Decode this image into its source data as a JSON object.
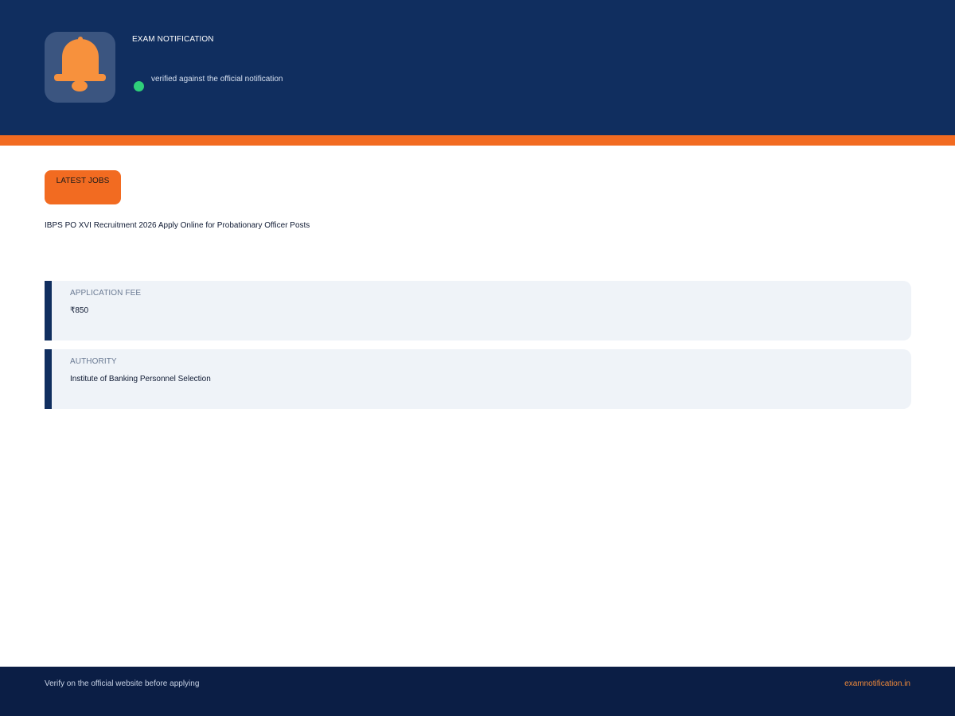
{
  "header": {
    "site_name": "EXAM NOTIFICATION",
    "verified_text": "verified against the official notification",
    "logo_icon": "bell-icon"
  },
  "colors": {
    "header_bg": "#102e5f",
    "accent": "#f26b21",
    "verified": "#2fd07a",
    "footer_bg": "#0b1e45"
  },
  "main": {
    "category": "LATEST JOBS",
    "title": "IBPS PO XVI Recruitment 2026 Apply Online for Probationary Officer Posts",
    "details": [
      {
        "label": "APPLICATION FEE",
        "value": "₹850"
      },
      {
        "label": "AUTHORITY",
        "value": "Institute of Banking Personnel Selection"
      }
    ]
  },
  "footer": {
    "note": "Verify on the official website before applying",
    "link": "examnotification.in"
  }
}
